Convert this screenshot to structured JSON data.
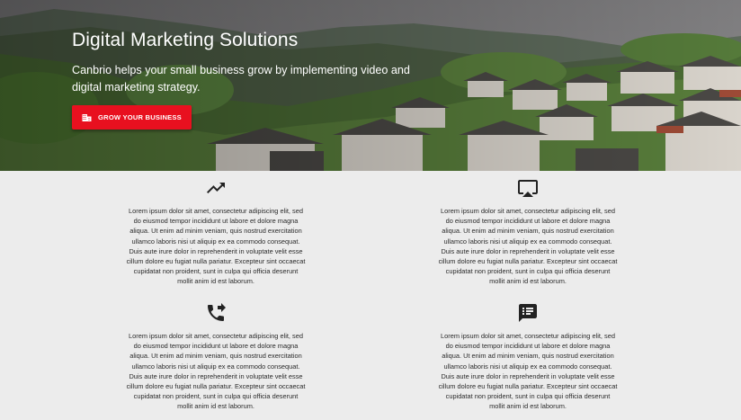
{
  "hero": {
    "title": "Digital Marketing Solutions",
    "subtitle": "Canbrio helps your small business grow by implementing video and digital marketing strategy.",
    "cta_label": "GROW YOUR BUSINESS",
    "cta_icon": "building-icon",
    "accent_color": "#e8101f"
  },
  "features": [
    {
      "icon": "trending-up-icon",
      "text": "Lorem ipsum dolor sit amet, consectetur adipiscing elit, sed do eiusmod tempor incididunt ut labore et dolore magna aliqua. Ut enim ad minim veniam, quis nostrud exercitation ullamco laboris nisi ut aliquip ex ea commodo consequat. Duis aute irure dolor in reprehenderit in voluptate velit esse cillum dolore eu fugiat nulla pariatur. Excepteur sint occaecat cupidatat non proident, sunt in culpa qui officia deserunt mollit anim id est laborum."
    },
    {
      "icon": "airplay-icon",
      "text": "Lorem ipsum dolor sit amet, consectetur adipiscing elit, sed do eiusmod tempor incididunt ut labore et dolore magna aliqua. Ut enim ad minim veniam, quis nostrud exercitation ullamco laboris nisi ut aliquip ex ea commodo consequat. Duis aute irure dolor in reprehenderit in voluptate velit esse cillum dolore eu fugiat nulla pariatur. Excepteur sint occaecat cupidatat non proident, sunt in culpa qui officia deserunt mollit anim id est laborum."
    },
    {
      "icon": "phone-forwarded-icon",
      "text": "Lorem ipsum dolor sit amet, consectetur adipiscing elit, sed do eiusmod tempor incididunt ut labore et dolore magna aliqua. Ut enim ad minim veniam, quis nostrud exercitation ullamco laboris nisi ut aliquip ex ea commodo consequat. Duis aute irure dolor in reprehenderit in voluptate velit esse cillum dolore eu fugiat nulla pariatur. Excepteur sint occaecat cupidatat non proident, sunt in culpa qui officia deserunt mollit anim id est laborum."
    },
    {
      "icon": "chat-list-icon",
      "text": "Lorem ipsum dolor sit amet, consectetur adipiscing elit, sed do eiusmod tempor incididunt ut labore et dolore magna aliqua. Ut enim ad minim veniam, quis nostrud exercitation ullamco laboris nisi ut aliquip ex ea commodo consequat. Duis aute irure dolor in reprehenderit in voluptate velit esse cillum dolore eu fugiat nulla pariatur. Excepteur sint occaecat cupidatat non proident, sunt in culpa qui officia deserunt mollit anim id est laborum."
    }
  ]
}
